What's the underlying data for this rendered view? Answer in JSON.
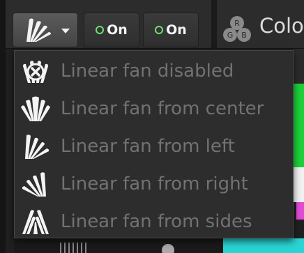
{
  "toolbar": {
    "fan_mode_icon": "fan-from-left-icon",
    "toggle_1": {
      "label": "On",
      "status_color": "#6de06d"
    },
    "toggle_2": {
      "label": "On",
      "status_color": "#6de06d"
    },
    "rgb_icon_letters": [
      "R",
      "G",
      "B"
    ],
    "color_label": "Colo"
  },
  "fan_menu": {
    "items": [
      {
        "label": "Linear fan disabled",
        "icon": "fan-disabled-icon"
      },
      {
        "label": "Linear fan from center",
        "icon": "fan-from-center-icon"
      },
      {
        "label": "Linear fan from left",
        "icon": "fan-from-left-icon"
      },
      {
        "label": "Linear fan from right",
        "icon": "fan-from-right-icon"
      },
      {
        "label": "Linear fan from sides",
        "icon": "fan-from-sides-icon"
      }
    ]
  },
  "colors": {
    "menu_text": "#727272",
    "icon_fill": "#f4f4f4",
    "status_on": "#6de06d"
  }
}
